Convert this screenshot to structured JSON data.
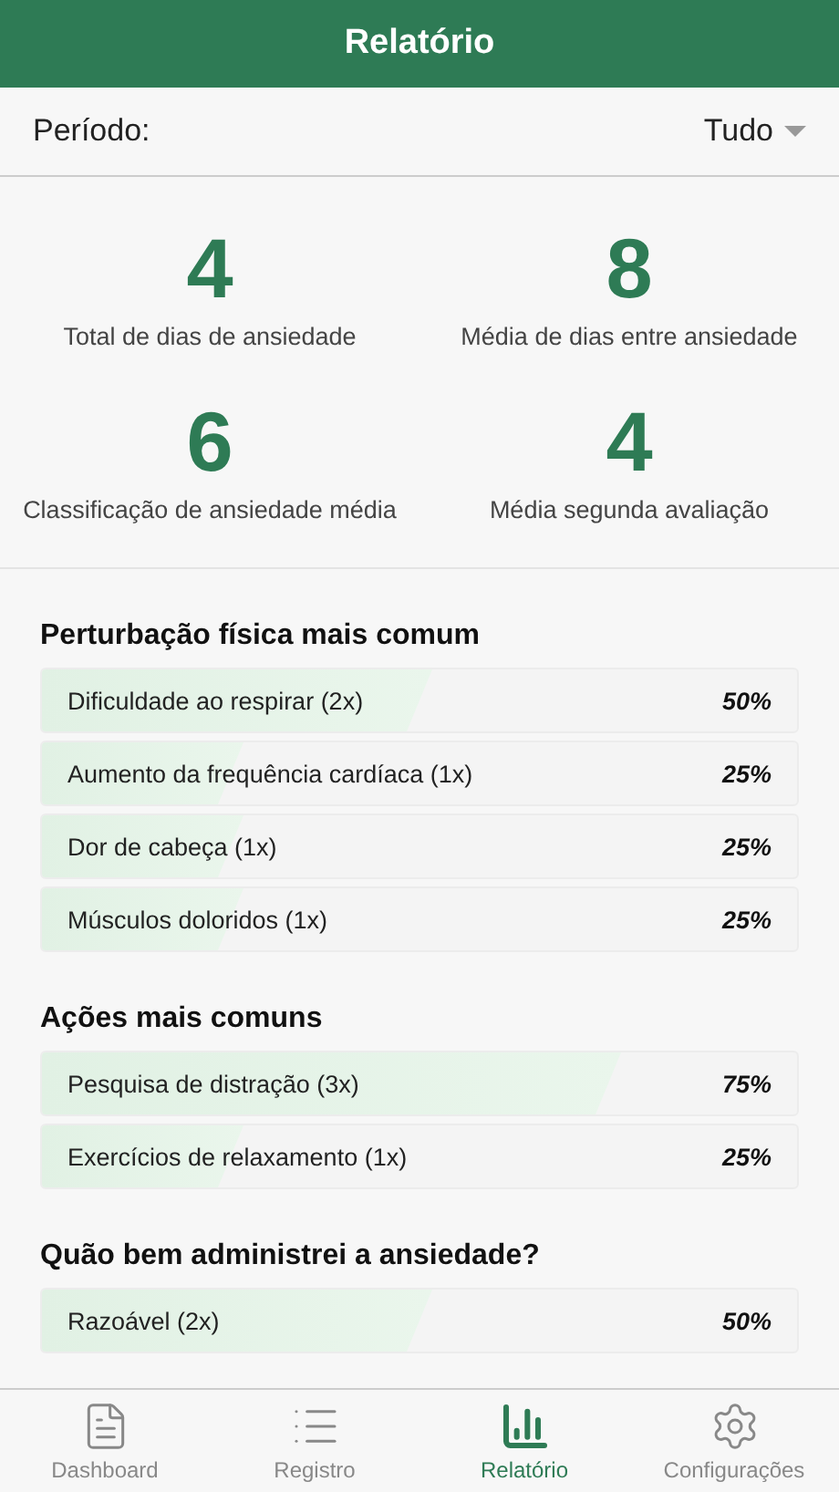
{
  "header": {
    "title": "Relatório"
  },
  "period": {
    "label": "Período:",
    "value": "Tudo"
  },
  "stats": [
    {
      "value": "4",
      "label": "Total de dias de ansiedade"
    },
    {
      "value": "8",
      "label": "Média de dias entre ansiedade"
    },
    {
      "value": "6",
      "label": "Classificação de ansiedade média"
    },
    {
      "value": "4",
      "label": "Média segunda avaliação"
    }
  ],
  "sections": [
    {
      "title": "Perturbação física mais comum",
      "rows": [
        {
          "label": "Dificuldade ao respirar (2x)",
          "percent": "50%",
          "level": 0.5
        },
        {
          "label": "Aumento da frequência cardíaca (1x)",
          "percent": "25%",
          "level": 0.25
        },
        {
          "label": "Dor de cabeça (1x)",
          "percent": "25%",
          "level": 0.25
        },
        {
          "label": "Músculos doloridos (1x)",
          "percent": "25%",
          "level": 0.25
        }
      ]
    },
    {
      "title": "Ações mais comuns",
      "rows": [
        {
          "label": "Pesquisa de distração (3x)",
          "percent": "75%",
          "level": 0.75
        },
        {
          "label": "Exercícios de relaxamento (1x)",
          "percent": "25%",
          "level": 0.25
        }
      ]
    },
    {
      "title": "Quão bem administrei a ansiedade?",
      "rows": [
        {
          "label": "Razoável (2x)",
          "percent": "50%",
          "level": 0.5
        }
      ]
    }
  ],
  "tabs": [
    {
      "label": "Dashboard",
      "kind": "doc",
      "selected": false
    },
    {
      "label": "Registro",
      "kind": "list",
      "selected": false
    },
    {
      "label": "Relatório",
      "kind": "chart",
      "selected": true
    },
    {
      "label": "Configurações",
      "kind": "gear",
      "selected": false
    }
  ]
}
